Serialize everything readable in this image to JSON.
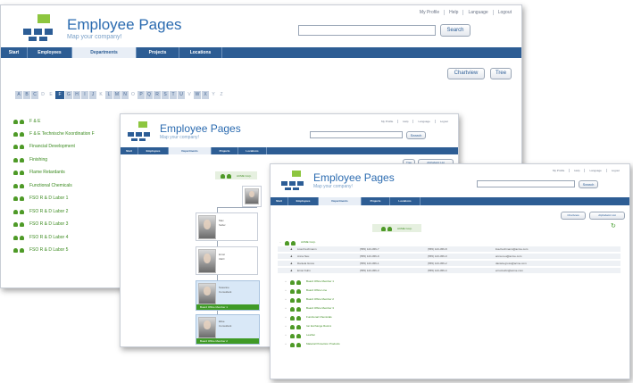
{
  "brand": {
    "title": "Employee Pages",
    "subtitle": "Map your company!"
  },
  "topbar": [
    "My Profile",
    "Help",
    "Language",
    "Logout"
  ],
  "search": {
    "button": "Search",
    "value": ""
  },
  "nav": [
    "Start",
    "Employees",
    "Departments",
    "Projects",
    "Locations"
  ],
  "active_nav": "Departments",
  "win1": {
    "buttons": [
      "Chartview",
      "Tree"
    ],
    "alphabet": [
      "A",
      "B",
      "C",
      "D",
      "E",
      "F",
      "G",
      "H",
      "I",
      "J",
      "K",
      "L",
      "M",
      "N",
      "O",
      "P",
      "Q",
      "R",
      "S",
      "T",
      "U",
      "V",
      "W",
      "X",
      "Y",
      "Z"
    ],
    "active_letters": [
      "F"
    ],
    "departments": [
      "F & E",
      "F & E Technische Koordination F",
      "Financial Development",
      "Finishing",
      "Flame Retardants",
      "Functional Chemicals",
      "FSO R & D Labor 1",
      "FSO R & D Labor 2",
      "FSO R & D Labor 3",
      "FSO R & D Labor 4",
      "FSO R & D Labor 5"
    ]
  },
  "win2": {
    "buttons": [
      "Tree",
      "Alphabetic List"
    ],
    "root": "ACME Corp.",
    "cards": [
      {
        "name": "Max",
        "title": "Seller"
      },
      {
        "name": "Ernst",
        "title": "CEO"
      },
      {
        "name": "Susanne",
        "title": "Consultant",
        "bar": "Board Office Member 1"
      },
      {
        "name": "Elise",
        "title": "Consultant",
        "bar": "Board Office Member 2"
      }
    ]
  },
  "win3": {
    "buttons": [
      "Chartview",
      "Alphabetic List"
    ],
    "root": "ACME Corp.",
    "tree_root": "ACME Corp.",
    "people": [
      {
        "name": "Lisa Frechmann",
        "phone1": "(555) 123-456-7",
        "phone2": "(555) 123-456-8",
        "email": "lisa.frechmann@acme.com"
      },
      {
        "name": "Anna Neu",
        "phone1": "(555) 123-456-9",
        "phone2": "(555) 123-456-0",
        "email": "anna.neu@acme.com"
      },
      {
        "name": "Daniela Gross",
        "phone1": "(555) 123-456-1",
        "phone2": "(555) 123-456-2",
        "email": "daniela.gross@acme.com"
      },
      {
        "name": "Ernst Kuhn",
        "phone1": "(555) 123-456-3",
        "phone2": "(555) 123-456-4",
        "email": "ernst.kuhn@acme.com"
      }
    ],
    "departments": [
      "Board Office Member 1",
      "Board Office Line",
      "Board Office Member 2",
      "Board Office Member 3",
      "Functional Chemicals",
      "Ion Exchange Resins",
      "Leather",
      "Material Protection Products"
    ]
  },
  "colors": {
    "nav": "#2d5d94",
    "brand": "#2b6bb0",
    "dept": "#3a8a1e"
  }
}
